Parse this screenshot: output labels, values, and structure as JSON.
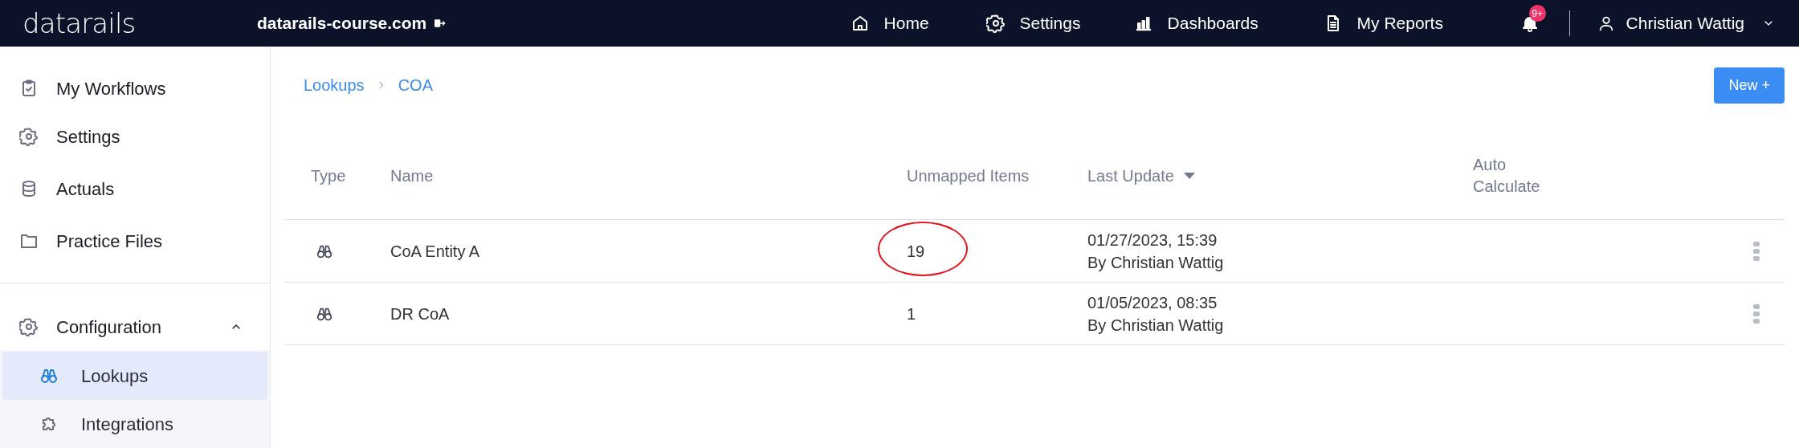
{
  "topbar": {
    "logo": "datarails",
    "site": "datarails-course.com",
    "nav": [
      {
        "label": "Home"
      },
      {
        "label": "Settings"
      },
      {
        "label": "Dashboards"
      },
      {
        "label": "My Reports"
      }
    ],
    "notifications": "9+",
    "user": "Christian Wattig"
  },
  "sidebar": {
    "items": [
      {
        "label": "My Workflows"
      },
      {
        "label": "Settings"
      },
      {
        "label": "Actuals"
      },
      {
        "label": "Practice Files"
      }
    ],
    "section": {
      "label": "Configuration",
      "expanded": true,
      "children": [
        {
          "label": "Lookups",
          "selected": true
        },
        {
          "label": "Integrations",
          "selected": false
        }
      ]
    }
  },
  "breadcrumbs": [
    "Lookups",
    "COA"
  ],
  "new_button": "New +",
  "table": {
    "columns": [
      {
        "label": "Type",
        "sorted": false
      },
      {
        "label": "Name",
        "sorted": false
      },
      {
        "label": "Unmapped Items",
        "sorted": false
      },
      {
        "label": "Last Update",
        "sorted": true
      },
      {
        "label": "Auto Calculate",
        "sorted": false
      }
    ],
    "rows": [
      {
        "name": "CoA Entity A",
        "unmapped": "19",
        "circled": true,
        "date": "01/27/2023, 15:39",
        "by": "By Christian Wattig"
      },
      {
        "name": "DR CoA",
        "unmapped": "1",
        "circled": false,
        "date": "01/05/2023, 08:35",
        "by": "By Christian Wattig"
      }
    ]
  }
}
